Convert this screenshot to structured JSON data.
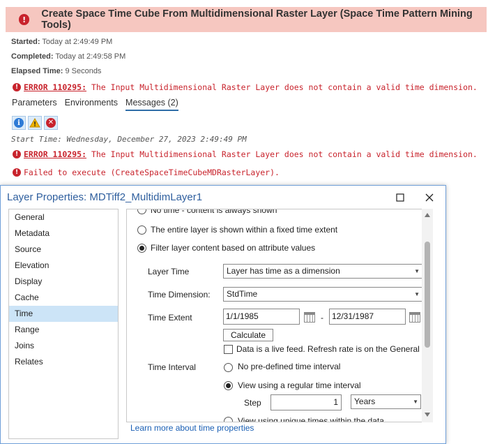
{
  "gp": {
    "title": "Create Space Time Cube From Multidimensional Raster Layer (Space Time Pattern Mining Tools)",
    "started_label": "Started:",
    "started_value": "Today at 2:49:49 PM",
    "completed_label": "Completed:",
    "completed_value": "Today at 2:49:58 PM",
    "elapsed_label": "Elapsed Time:",
    "elapsed_value": "9 Seconds",
    "error_code": "ERROR 110295:",
    "error_message": "The Input Multidimensional Raster Layer does not contain a valid time dimension.",
    "tabs": [
      "Parameters",
      "Environments",
      "Messages (2)"
    ],
    "start_time_line": "Start Time: Wednesday, December 27, 2023 2:49:49 PM",
    "failed_message": "Failed to execute (CreateSpaceTimeCubeMDRasterLayer).",
    "colors": {
      "error": "#c8232c",
      "header_bg": "#f6c7c0",
      "link": "#1a5fb4"
    }
  },
  "dialog": {
    "title": "Layer Properties: MDTiff2_MultidimLayer1",
    "nav": [
      "General",
      "Metadata",
      "Source",
      "Elevation",
      "Display",
      "Cache",
      "Time",
      "Range",
      "Joins",
      "Relates"
    ],
    "selected_nav": "Time",
    "option_cutoff": "No time - content is always shown",
    "option_fixed": "The entire layer is shown within a fixed time extent",
    "option_filter": "Filter layer content based on attribute values",
    "layer_time_label": "Layer Time",
    "layer_time_value": "Layer has time as a dimension",
    "time_dimension_label": "Time Dimension:",
    "time_dimension_value": "StdTime",
    "time_extent_label": "Time Extent",
    "extent_start": "1/1/1985",
    "extent_dash": "-",
    "extent_end": "12/31/1987",
    "calculate_label": "Calculate",
    "live_feed_label": "Data is a live feed. Refresh rate is on the General tab",
    "time_interval_label": "Time Interval",
    "interval_none": "No pre-defined time interval",
    "interval_regular": "View using a regular time interval",
    "step_label": "Step",
    "step_value": "1",
    "step_unit": "Years",
    "interval_unique": "View using unique times within the data",
    "learn_more": "Learn more about time properties"
  }
}
